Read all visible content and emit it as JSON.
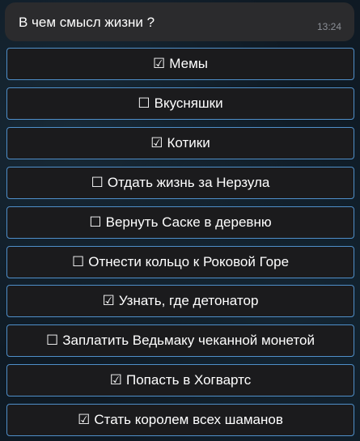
{
  "message": {
    "question": "В чем смысл жизни ?",
    "time": "13:24"
  },
  "options": [
    {
      "mark": "☑",
      "label": "Мемы"
    },
    {
      "mark": "☐",
      "label": "Вкусняшки"
    },
    {
      "mark": "☑",
      "label": "Котики"
    },
    {
      "mark": "☐",
      "label": "Отдать жизнь за Нерзула"
    },
    {
      "mark": "☐",
      "label": "Вернуть Саске в деревню"
    },
    {
      "mark": "☐",
      "label": "Отнести кольцо к Роковой Горе"
    },
    {
      "mark": "☑",
      "label": "Узнать, где детонатор"
    },
    {
      "mark": "☐",
      "label": "Заплатить Ведьмаку чеканной монетой"
    },
    {
      "mark": "☑",
      "label": "Попасть в Хогвартс"
    },
    {
      "mark": "☑",
      "label": "Стать королем всех шаманов"
    }
  ],
  "colors": {
    "button_border": "#4f8fc9",
    "button_bg": "#1b1b1d",
    "bubble_bg": "#2b2b2d"
  }
}
